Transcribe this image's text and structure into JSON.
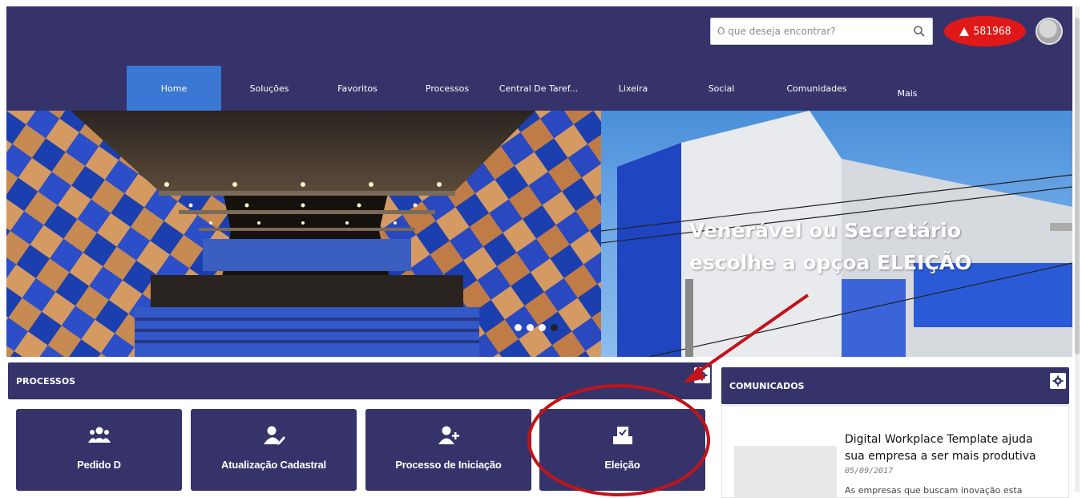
{
  "search": {
    "placeholder": "O que deseja encontrar?"
  },
  "alert": {
    "count": "581968",
    "color": "#e01818"
  },
  "nav": {
    "tabs": [
      {
        "label": "Home",
        "active": true
      },
      {
        "label": "Soluções"
      },
      {
        "label": "Favoritos"
      },
      {
        "label": "Processos"
      },
      {
        "label": "Central De Taref..."
      },
      {
        "label": "Lixeira"
      },
      {
        "label": "Social"
      },
      {
        "label": "Comunidades"
      },
      {
        "label": "Mais"
      }
    ]
  },
  "banner": {
    "overlay_text": "Venerável ou Secretário escolhe a opçoa ELEIÇÃO",
    "slides": 4,
    "active_slide": 4
  },
  "processos": {
    "title": "PROCESSOS",
    "cards": [
      {
        "label": "Pedido D",
        "icon": "users-icon"
      },
      {
        "label": "Atualização Cadastral",
        "icon": "user-edit-icon"
      },
      {
        "label": "Processo de Iniciação",
        "icon": "user-plus-icon"
      },
      {
        "label": "Eleição",
        "icon": "vote-box-icon"
      }
    ]
  },
  "comunicados": {
    "title": "COMUNICADOS",
    "item": {
      "title": "Digital Workplace Template ajuda sua empresa a ser mais produtiva",
      "date": "05/09/2017",
      "excerpt": "As empresas que buscam inovação esta"
    }
  },
  "colors": {
    "brand": "#35336a",
    "active_tab": "#3a78d4",
    "annotation": "#c0141a"
  }
}
